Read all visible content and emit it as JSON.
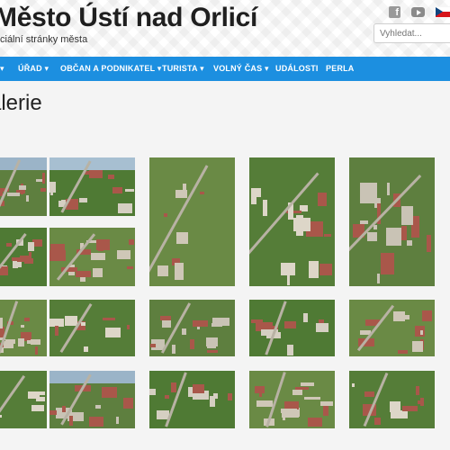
{
  "header": {
    "title": "Město Ústí nad Orlicí",
    "subtitle": "ciální stránky města",
    "social": [
      "facebook-icon",
      "youtube-icon",
      "czech-flag-icon"
    ]
  },
  "search": {
    "placeholder": "Vyhledat..."
  },
  "nav": {
    "items": [
      {
        "label": "▾"
      },
      {
        "label": "ÚŘAD ▾"
      },
      {
        "label": "OBČAN A PODNIKATEL ▾"
      },
      {
        "label": "TURISTA ▾"
      },
      {
        "label": "VOLNÝ ČAS ▾"
      },
      {
        "label": "UDÁLOSTI"
      },
      {
        "label": "PERLA"
      }
    ]
  },
  "page": {
    "title": "alerie"
  },
  "colors": {
    "nav_bg": "#1c8fe0",
    "page_bg": "#f4f4f4"
  },
  "gallery": {
    "thumb_kind": "aerial-photo",
    "rows": 4,
    "columns": 5
  }
}
